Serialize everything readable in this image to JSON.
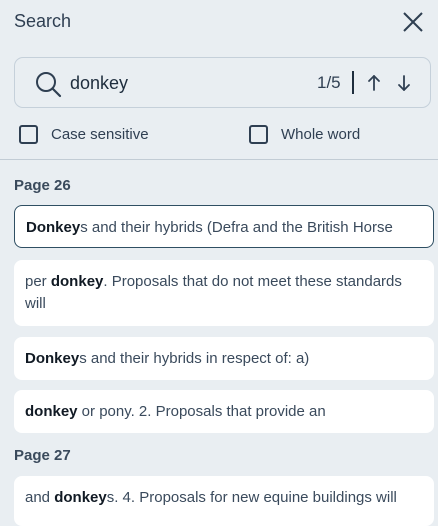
{
  "header": {
    "title": "Search"
  },
  "search": {
    "query": "donkey",
    "match_count": "1/5"
  },
  "options": {
    "case_sensitive_label": "Case sensitive",
    "whole_word_label": "Whole word"
  },
  "results": {
    "groups": [
      {
        "page_label": "Page 26",
        "items": [
          {
            "before": "",
            "match": "Donkey",
            "after": "s and their hybrids (Defra and the British Horse"
          },
          {
            "before": "per ",
            "match": "donkey",
            "after": ". Proposals that do not meet these standards will"
          },
          {
            "before": "",
            "match": "Donkey",
            "after": "s and their hybrids in respect of: a)"
          },
          {
            "before": "",
            "match": "donkey",
            "after": " or pony. 2. Proposals that provide an"
          }
        ]
      },
      {
        "page_label": "Page 27",
        "items": [
          {
            "before": "and ",
            "match": "donkey",
            "after": "s. 4. Proposals for new equine buildings will"
          }
        ]
      }
    ]
  },
  "colors": {
    "background": "#e9eef2",
    "card": "#ffffff",
    "active_border": "#2f4f63",
    "text": "#1e2d3d"
  }
}
